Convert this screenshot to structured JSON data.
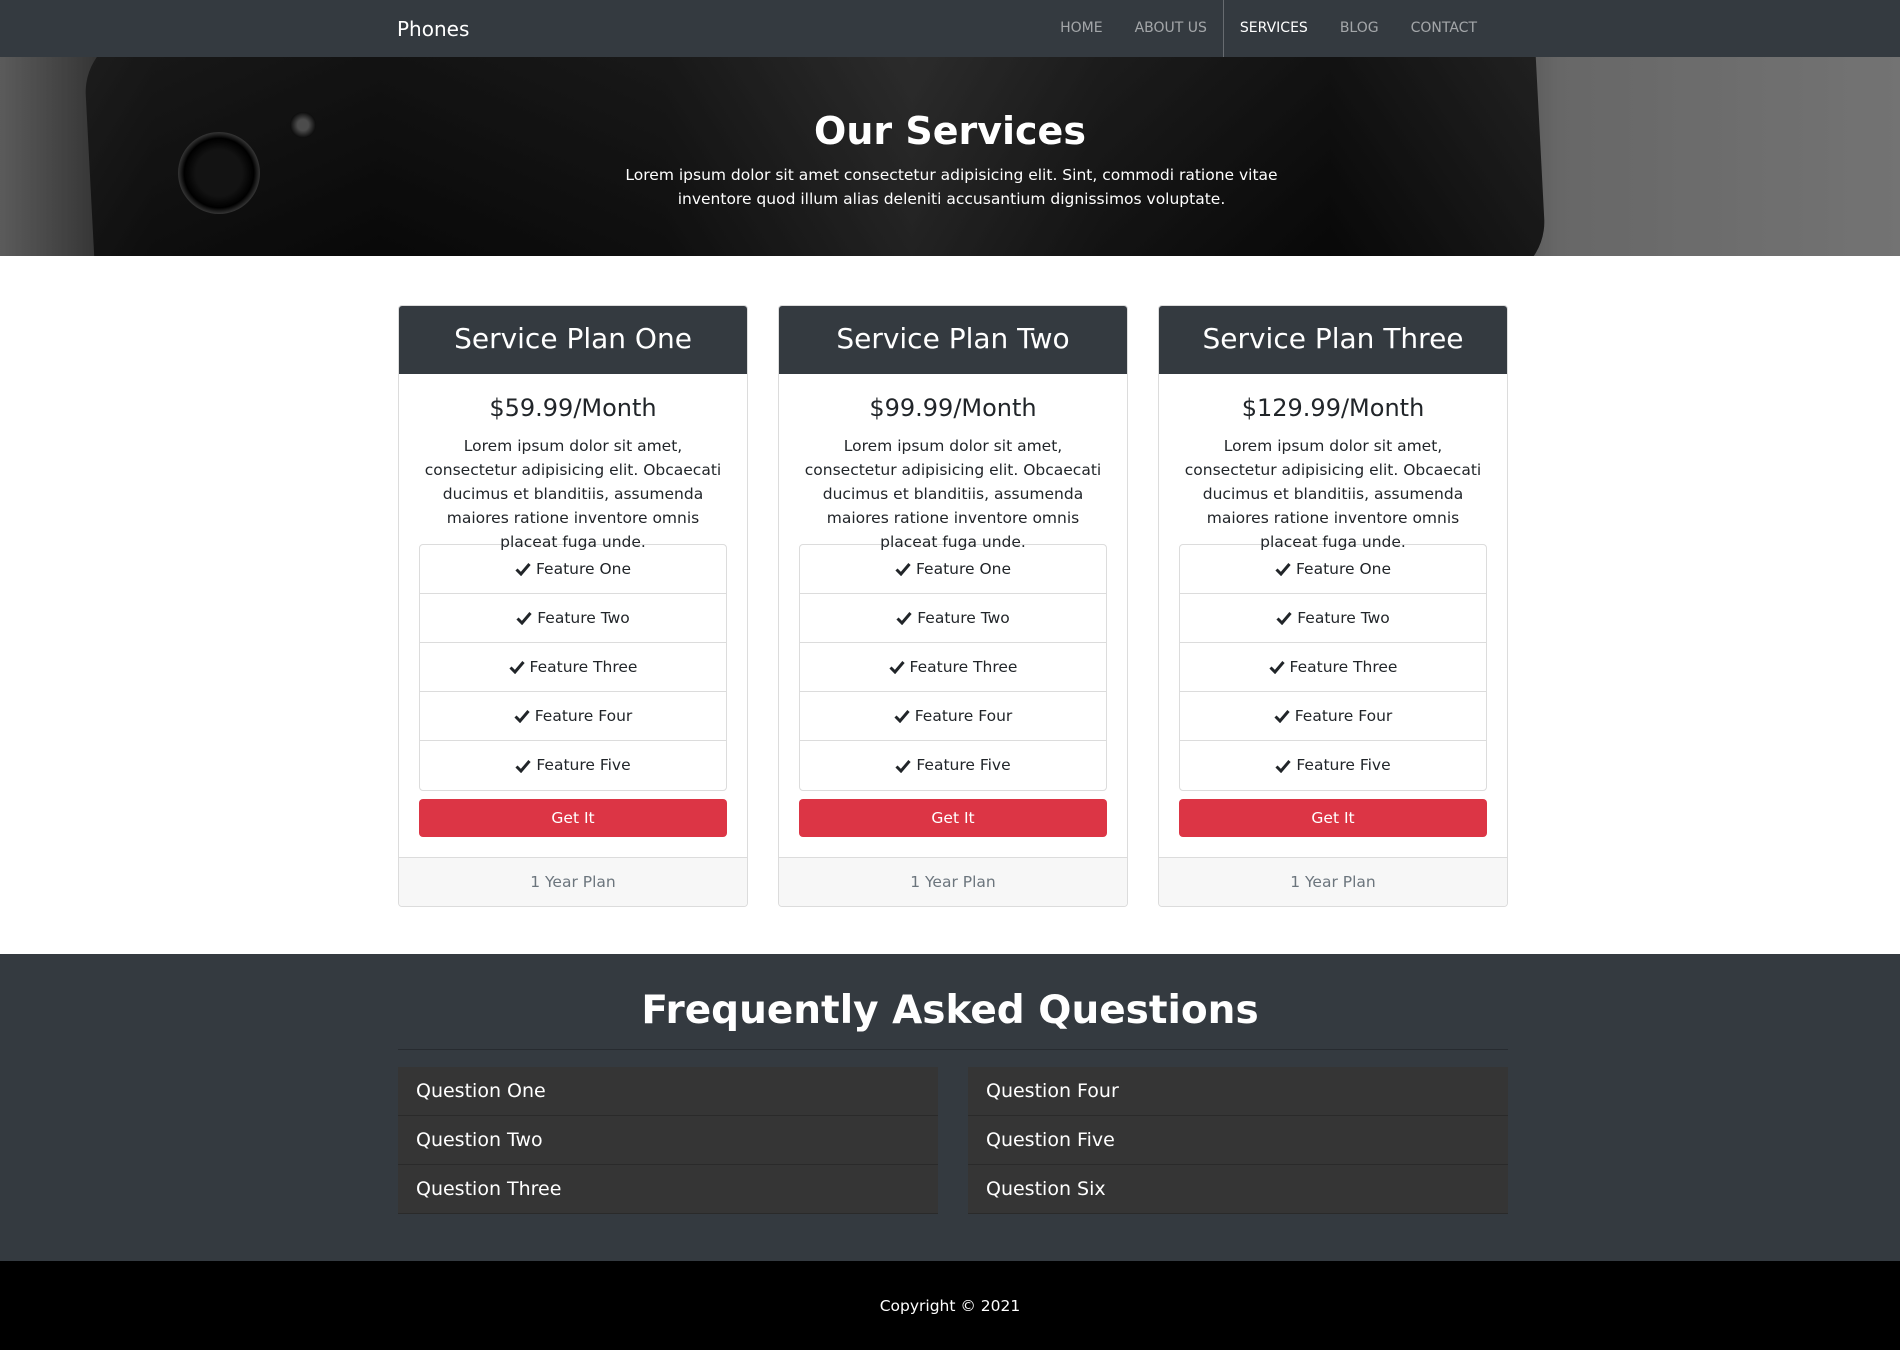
{
  "navbar": {
    "brand": "Phones",
    "links": [
      {
        "label": "HOME"
      },
      {
        "label": "ABOUT US"
      },
      {
        "label": "SERVICES"
      },
      {
        "label": "BLOG"
      },
      {
        "label": "CONTACT"
      }
    ],
    "active": "SERVICES"
  },
  "hero": {
    "title": "Our Services",
    "text": "Lorem ipsum dolor sit amet consectetur adipisicing elit. Sint, commodi ratione vitae inventore quod illum alias deleniti accusantium dignissimos voluptate."
  },
  "plans": [
    {
      "title": "Service Plan One",
      "price": "$59.99/Month",
      "text": "Lorem ipsum dolor sit amet, consectetur adipisicing elit. Obcaecati ducimus et blanditiis, assumenda maiores ratione inventore omnis placeat fuga unde.",
      "features": [
        "Feature One",
        "Feature Two",
        "Feature Three",
        "Feature Four",
        "Feature Five"
      ],
      "button": "Get It",
      "footer": "1 Year Plan"
    },
    {
      "title": "Service Plan Two",
      "price": "$99.99/Month",
      "text": "Lorem ipsum dolor sit amet, consectetur adipisicing elit. Obcaecati ducimus et blanditiis, assumenda maiores ratione inventore omnis placeat fuga unde.",
      "features": [
        "Feature One",
        "Feature Two",
        "Feature Three",
        "Feature Four",
        "Feature Five"
      ],
      "button": "Get It",
      "footer": "1 Year Plan"
    },
    {
      "title": "Service Plan Three",
      "price": "$129.99/Month",
      "text": "Lorem ipsum dolor sit amet, consectetur adipisicing elit. Obcaecati ducimus et blanditiis, assumenda maiores ratione inventore omnis placeat fuga unde.",
      "features": [
        "Feature One",
        "Feature Two",
        "Feature Three",
        "Feature Four",
        "Feature Five"
      ],
      "button": "Get It",
      "footer": "1 Year Plan"
    }
  ],
  "faq": {
    "title": "Frequently Asked Questions",
    "left": [
      "Question One",
      "Question Two",
      "Question Three"
    ],
    "right": [
      "Question Four",
      "Question Five",
      "Question Six"
    ]
  },
  "footer": {
    "copyright": "Copyright © 2021"
  },
  "icons": {
    "feature": "check-icon"
  },
  "colors": {
    "dark": "#343a40",
    "accent": "#dc3545",
    "footer": "#000000"
  }
}
